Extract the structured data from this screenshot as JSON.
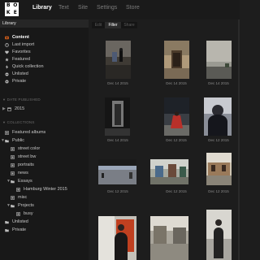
{
  "app": {
    "logo_letters": [
      "B",
      "O",
      "K",
      "E"
    ],
    "nav": [
      "Library",
      "Text",
      "Site",
      "Settings",
      "Store"
    ],
    "active_nav": "Library"
  },
  "sidebar": {
    "title": "Library",
    "items": [
      {
        "label": "Content",
        "icon": "content-icon"
      },
      {
        "label": "Last import",
        "icon": "clock-icon"
      },
      {
        "label": "Favorites",
        "icon": "heart-icon"
      },
      {
        "label": "Featured",
        "icon": "star-icon"
      },
      {
        "label": "Quick collection",
        "icon": "lightning-icon"
      },
      {
        "label": "Unlisted",
        "icon": "unlisted-icon"
      },
      {
        "label": "Private",
        "icon": "private-icon"
      }
    ],
    "date_section": "DATE PUBLISHED",
    "years": [
      {
        "label": "2015"
      }
    ],
    "collections_section": "COLLECTIONS",
    "collections": [
      {
        "label": "Featured albums",
        "depth": 0
      },
      {
        "label": "Public",
        "depth": 0
      },
      {
        "label": "street color",
        "depth": 1
      },
      {
        "label": "street bw",
        "depth": 1
      },
      {
        "label": "portraits",
        "depth": 1
      },
      {
        "label": "news",
        "depth": 1
      },
      {
        "label": "Essays",
        "depth": 1
      },
      {
        "label": "Hamburg Winter 2015",
        "depth": 2
      },
      {
        "label": "misc",
        "depth": 1
      },
      {
        "label": "Projects",
        "depth": 1
      },
      {
        "label": "busy",
        "depth": 2
      },
      {
        "label": "Unlisted",
        "depth": 0
      },
      {
        "label": "Private",
        "depth": 0
      }
    ]
  },
  "toolbar": {
    "tabs": [
      "Edit",
      "Filter",
      "Share"
    ],
    "active_tab": "Filter"
  },
  "grid": {
    "items": [
      {
        "caption": "Dec 14 2015"
      },
      {
        "caption": "Dec 14 2015"
      },
      {
        "caption": "Dec 14 2015"
      },
      {
        "caption": "Dec 14 2015"
      },
      {
        "caption": "Dec 12 2015"
      },
      {
        "caption": "Dec 12 2015"
      },
      {
        "caption": "Dec 12 2015"
      },
      {
        "caption": "Dec 12 2015"
      },
      {
        "caption": "Dec 12 2015"
      },
      {
        "caption": ""
      },
      {
        "caption": ""
      },
      {
        "caption": ""
      }
    ]
  },
  "colors": {
    "accent": "#e8651a",
    "background": "#1d1d1d",
    "sidebar": "#181818"
  }
}
